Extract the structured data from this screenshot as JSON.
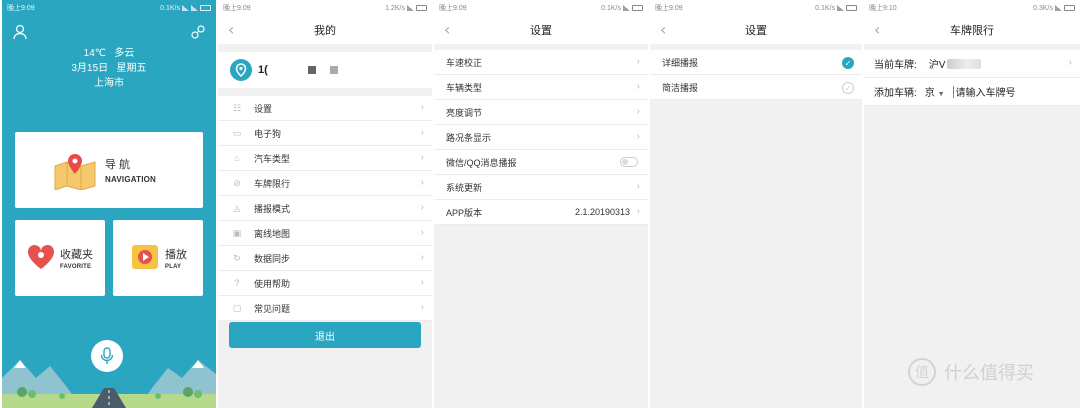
{
  "status": {
    "time1": "晚上9:09",
    "time2": "晚上9:09",
    "time3": "晚上9:09",
    "time4": "晚上9:09",
    "time5": "晚上9:10",
    "speed": "0.1K/s",
    "speed2": "1.2K/s",
    "speed3": "0.1K/s",
    "speed4": "0.1K/s",
    "speed5": "0.3K/s"
  },
  "home": {
    "temperature": "14℃",
    "weather": "多云",
    "date": "3月15日",
    "weekday": "星期五",
    "city": "上海市",
    "nav_cn": "导 航",
    "nav_en": "NAVIGATION",
    "fav_cn": "收藏夹",
    "fav_en": "FAVORITE",
    "play_cn": "播放",
    "play_en": "PLAY"
  },
  "mine": {
    "title": "我的",
    "username": "1(",
    "menu": [
      {
        "label": "设置",
        "icon": "sliders-icon"
      },
      {
        "label": "电子狗",
        "icon": "camera-icon"
      },
      {
        "label": "汽车类型",
        "icon": "car-icon"
      },
      {
        "label": "车牌限行",
        "icon": "ban-icon"
      },
      {
        "label": "播报模式",
        "icon": "broadcast-icon"
      },
      {
        "label": "离线地图",
        "icon": "map-icon"
      },
      {
        "label": "数据同步",
        "icon": "sync-icon"
      },
      {
        "label": "使用帮助",
        "icon": "help-icon"
      },
      {
        "label": "常见问题",
        "icon": "faq-icon"
      }
    ],
    "logout": "退出"
  },
  "settings": {
    "title": "设置",
    "items": [
      {
        "label": "车速校正"
      },
      {
        "label": "车辆类型"
      },
      {
        "label": "亮度调节"
      },
      {
        "label": "路况条显示"
      },
      {
        "label": "微信/QQ消息播报"
      },
      {
        "label": "系统更新"
      },
      {
        "label": "APP版本",
        "value": "2.1.20190313"
      }
    ]
  },
  "broadcast": {
    "title": "设置",
    "options": [
      {
        "label": "详细播报",
        "selected": true
      },
      {
        "label": "简洁播报",
        "selected": false
      }
    ]
  },
  "plate": {
    "title": "车牌限行",
    "current_label": "当前车牌:",
    "current_value": "沪V",
    "add_label": "添加车辆:",
    "province": "京",
    "placeholder": "请输入车牌号"
  },
  "watermark": {
    "symbol": "值",
    "text": "什么值得买"
  },
  "colors": {
    "accent": "#2aa6c1",
    "background": "#f1f1f1"
  }
}
